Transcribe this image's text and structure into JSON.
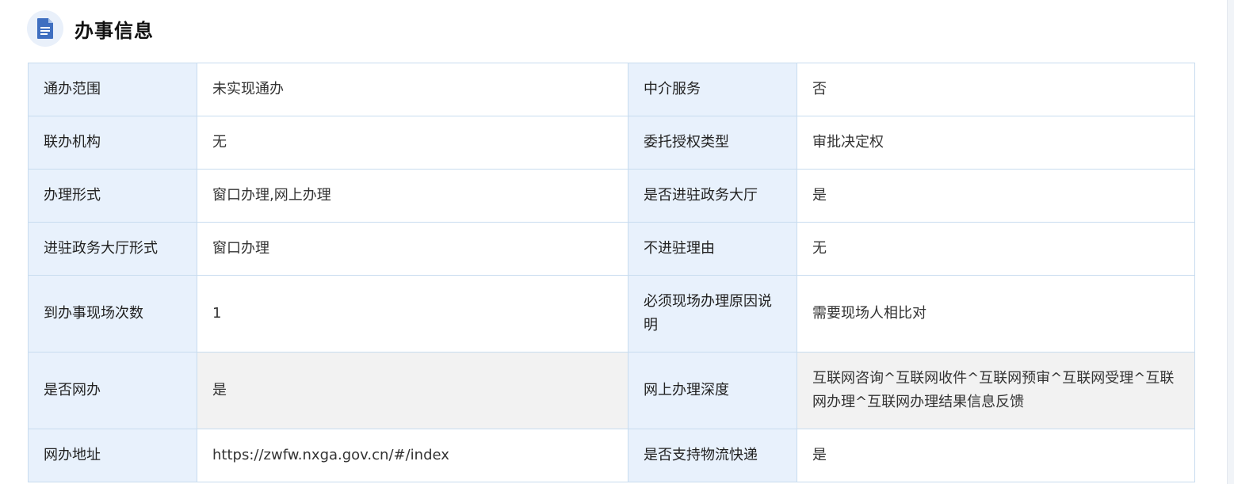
{
  "section": {
    "title": "办事信息",
    "icon": "document-icon"
  },
  "colors": {
    "label_bg": "#e8f1fc",
    "border": "#c8dcef",
    "icon_blue": "#3f6fc0",
    "shaded_row_bg": "#f2f2f2"
  },
  "rows": [
    {
      "l1": "通办范围",
      "v1": "未实现通办",
      "l2": "中介服务",
      "v2": "否"
    },
    {
      "l1": "联办机构",
      "v1": "无",
      "l2": "委托授权类型",
      "v2": "审批决定权"
    },
    {
      "l1": "办理形式",
      "v1": "窗口办理,网上办理",
      "l2": "是否进驻政务大厅",
      "v2": "是"
    },
    {
      "l1": "进驻政务大厅形式",
      "v1": "窗口办理",
      "l2": "不进驻理由",
      "v2": "无"
    },
    {
      "l1": "到办事现场次数",
      "v1": "1",
      "l2": "必须现场办理原因说明",
      "v2": "需要现场人相比对"
    },
    {
      "l1": "是否网办",
      "v1": "是",
      "l2": "网上办理深度",
      "v2": "互联网咨询^互联网收件^互联网预审^互联网受理^互联网办理^互联网办理结果信息反馈"
    },
    {
      "l1": "网办地址",
      "v1": "https://zwfw.nxga.gov.cn/#/index",
      "l2": "是否支持物流快递",
      "v2": "是"
    }
  ]
}
